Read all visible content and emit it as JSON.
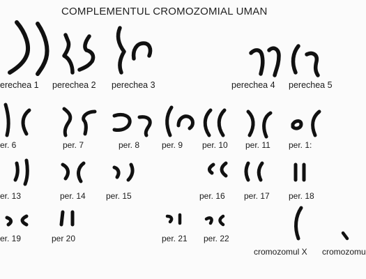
{
  "title": "COMPLEMENTUL CROMOZOMIAL UMAN",
  "labels": {
    "p1": "erechea 1",
    "p2": "perechea 2",
    "p3": "perechea 3",
    "p4": "perechea 4",
    "p5": "perechea 5",
    "p6": "er. 6",
    "p7": "per. 7",
    "p8": "per. 8",
    "p9": "per. 9",
    "p10": "per. 10",
    "p11": "per. 11",
    "p12": "per. 1:",
    "p13": "er. 13",
    "p14": "per. 14",
    "p15": "per. 15",
    "p16": "per. 16",
    "p17": "per. 17",
    "p18": "per. 18",
    "p19": "er. 19",
    "p20": "per 20",
    "p21": "per. 21",
    "p22": "per. 22",
    "px": "cromozomul X",
    "py": "cromozomu"
  },
  "ink_color": "#111111"
}
